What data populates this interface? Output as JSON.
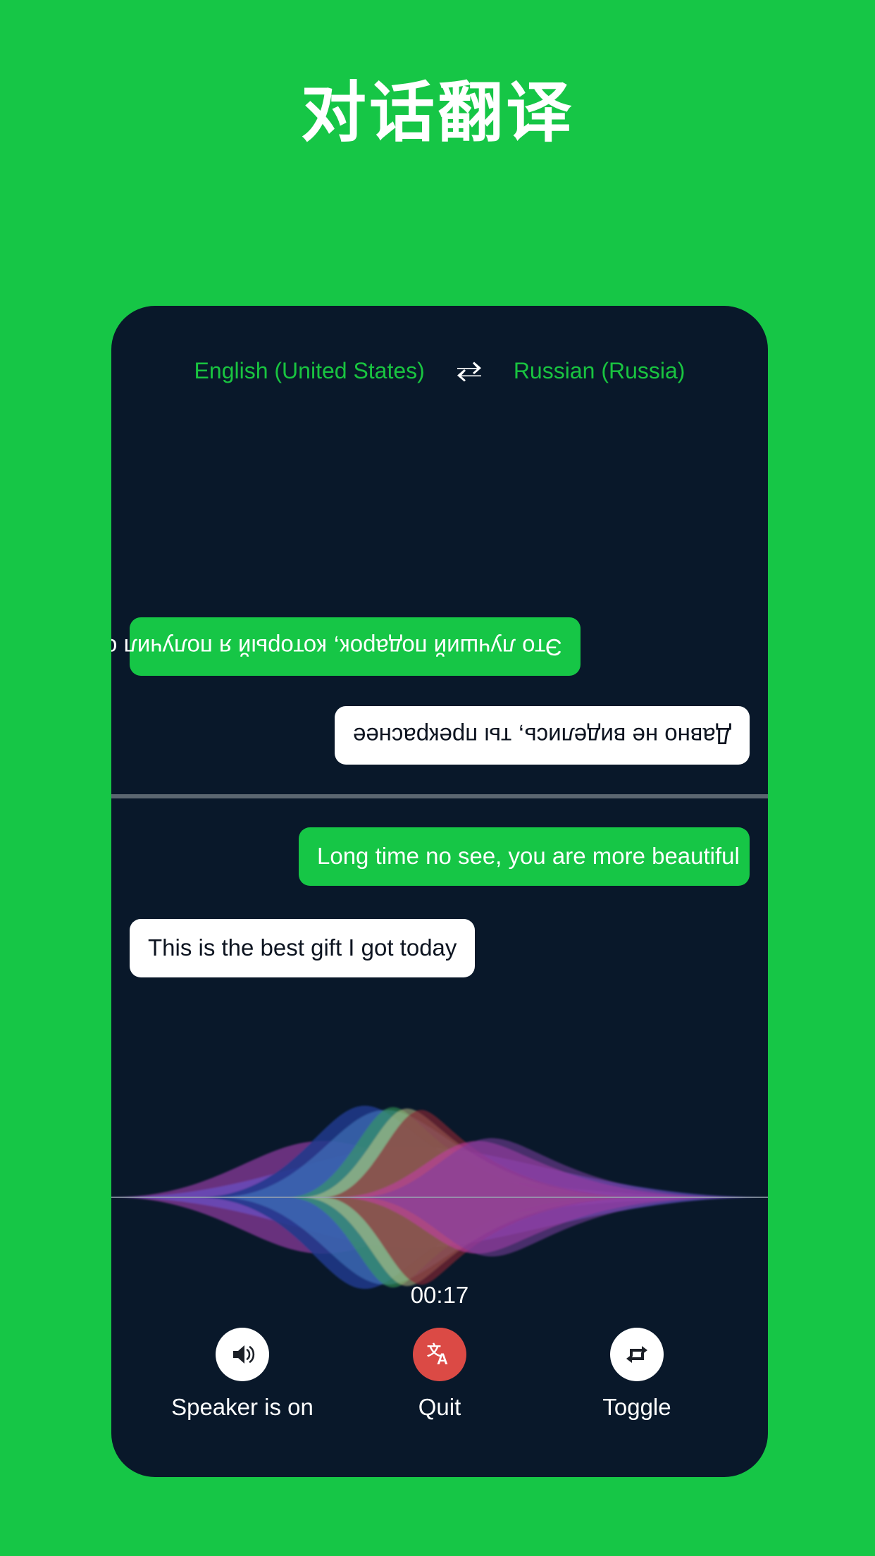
{
  "page": {
    "title": "对话翻译",
    "background_color": "#16C646",
    "panel_color": "#09182A",
    "accent_green": "#16C646",
    "danger_red": "#DB4A45"
  },
  "language_bar": {
    "source_language": "English (United States)",
    "swap_icon": "swap-horizontal-icon",
    "target_language": "Russian (Russia)",
    "label_color": "#19C440"
  },
  "conversation": {
    "translated_panel": {
      "messages": [
        {
          "id": "ru-1",
          "text": "Это лучший подарок, который я получил сегодня",
          "style": "green",
          "align": "left",
          "rotated": true
        },
        {
          "id": "ru-2",
          "text": "Давно не виделись, ты прекраснее",
          "style": "white",
          "align": "right",
          "rotated": true
        }
      ]
    },
    "source_panel": {
      "messages": [
        {
          "id": "en-1",
          "text": "Long time no see, you are more beautiful",
          "style": "green",
          "align": "right",
          "rotated": false
        },
        {
          "id": "en-2",
          "text": "This is the best gift I got today",
          "style": "white",
          "align": "left",
          "rotated": false
        }
      ]
    }
  },
  "waveform": {
    "description": "siri-style-voice-waveform",
    "lobe_colors": [
      "#1E3A8C",
      "#3C6FBE",
      "#2E9E4F",
      "#C9C98A",
      "#8B2230",
      "#C23EA5",
      "#7B3FA0",
      "#5B5BD6"
    ],
    "baseline_color": "#9AA6B2"
  },
  "timer": {
    "elapsed": "00:17"
  },
  "controls": [
    {
      "id": "speaker",
      "icon": "speaker-on-icon",
      "label": "Speaker is on",
      "circle_style": "light"
    },
    {
      "id": "quit",
      "icon": "translate-icon",
      "label": "Quit",
      "circle_style": "danger"
    },
    {
      "id": "toggle",
      "icon": "repeat-loop-icon",
      "label": "Toggle",
      "circle_style": "light"
    }
  ]
}
